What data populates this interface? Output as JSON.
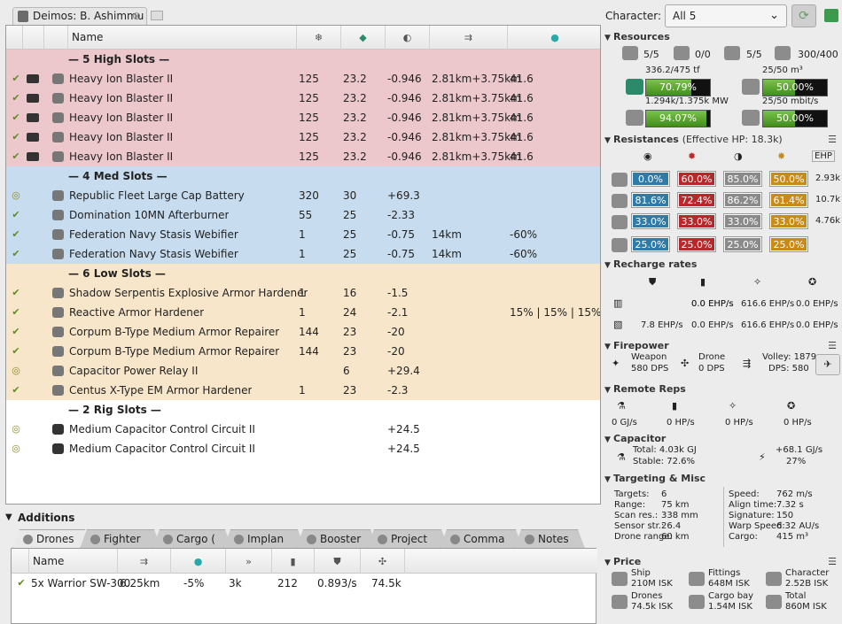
{
  "tab_title": "Deimos: B. Ashimmu",
  "columns": {
    "name": "Name"
  },
  "slot_sections": [
    {
      "id": "high",
      "label": "— 5 High Slots —",
      "color": "#ecc8cc",
      "rows": [
        {
          "state": "check",
          "name": "Heavy Ion Blaster II",
          "c1": "125",
          "c2": "23.2",
          "c3": "-0.946",
          "c4": "2.81km+3.75km",
          "c5": "41.6"
        },
        {
          "state": "check",
          "name": "Heavy Ion Blaster II",
          "c1": "125",
          "c2": "23.2",
          "c3": "-0.946",
          "c4": "2.81km+3.75km",
          "c5": "41.6"
        },
        {
          "state": "check",
          "name": "Heavy Ion Blaster II",
          "c1": "125",
          "c2": "23.2",
          "c3": "-0.946",
          "c4": "2.81km+3.75km",
          "c5": "41.6"
        },
        {
          "state": "check",
          "name": "Heavy Ion Blaster II",
          "c1": "125",
          "c2": "23.2",
          "c3": "-0.946",
          "c4": "2.81km+3.75km",
          "c5": "41.6"
        },
        {
          "state": "check",
          "name": "Heavy Ion Blaster II",
          "c1": "125",
          "c2": "23.2",
          "c3": "-0.946",
          "c4": "2.81km+3.75km",
          "c5": "41.6"
        }
      ]
    },
    {
      "id": "med",
      "label": "— 4 Med Slots —",
      "color": "#c7dcef",
      "rows": [
        {
          "state": "circle",
          "name": "Republic Fleet Large Cap Battery",
          "c1": "320",
          "c2": "30",
          "c3": "+69.3",
          "c4": "",
          "c5": ""
        },
        {
          "state": "check",
          "name": "Domination 10MN Afterburner",
          "c1": "55",
          "c2": "25",
          "c3": "-2.33",
          "c4": "",
          "c5": ""
        },
        {
          "state": "check",
          "name": "Federation Navy Stasis Webifier",
          "c1": "1",
          "c2": "25",
          "c3": "-0.75",
          "c4": "14km",
          "c5": "-60%"
        },
        {
          "state": "check",
          "name": "Federation Navy Stasis Webifier",
          "c1": "1",
          "c2": "25",
          "c3": "-0.75",
          "c4": "14km",
          "c5": "-60%"
        }
      ]
    },
    {
      "id": "low",
      "label": "— 6 Low Slots —",
      "color": "#f7e6c9",
      "rows": [
        {
          "state": "check",
          "name": "Shadow Serpentis Explosive Armor Hardener",
          "c1": "1",
          "c2": "16",
          "c3": "-1.5",
          "c4": "",
          "c5": ""
        },
        {
          "state": "check",
          "name": "Reactive Armor Hardener",
          "c1": "1",
          "c2": "24",
          "c3": "-2.1",
          "c4": "",
          "c5": "15% | 15% | 15% | 15"
        },
        {
          "state": "check",
          "name": "Corpum B-Type Medium Armor Repairer",
          "c1": "144",
          "c2": "23",
          "c3": "-20",
          "c4": "",
          "c5": ""
        },
        {
          "state": "check",
          "name": "Corpum B-Type Medium Armor Repairer",
          "c1": "144",
          "c2": "23",
          "c3": "-20",
          "c4": "",
          "c5": ""
        },
        {
          "state": "circle",
          "name": "Capacitor Power Relay II",
          "c1": "",
          "c2": "6",
          "c3": "+29.4",
          "c4": "",
          "c5": ""
        },
        {
          "state": "check",
          "name": "Centus X-Type EM Armor Hardener",
          "c1": "1",
          "c2": "23",
          "c3": "-2.3",
          "c4": "",
          "c5": ""
        }
      ]
    },
    {
      "id": "rig",
      "label": "— 2 Rig Slots —",
      "color": "#ffffff",
      "rows": [
        {
          "state": "circle",
          "name": "Medium Capacitor Control Circuit II",
          "c1": "",
          "c2": "",
          "c3": "+24.5",
          "c4": "",
          "c5": ""
        },
        {
          "state": "circle",
          "name": "Medium Capacitor Control Circuit II",
          "c1": "",
          "c2": "",
          "c3": "+24.5",
          "c4": "",
          "c5": ""
        }
      ]
    }
  ],
  "additions": {
    "label": "Additions",
    "tabs": [
      "Drones",
      "Fighter",
      "Cargo (",
      "Implan",
      "Booster",
      "Project",
      "Comma",
      "Notes"
    ],
    "drone_header": "Name",
    "drone_row": {
      "name": "5x Warrior SW-300",
      "range": "6.25km",
      "tracking": "-5%",
      "speed": "3k",
      "hp": "212",
      "dps": "0.893/s",
      "volley": "74.5k"
    }
  },
  "character": {
    "label": "Character:",
    "value": "All 5"
  },
  "resources": {
    "title": "Resources",
    "hardpoints": [
      "5/5",
      "0/0",
      "5/5",
      "300/400"
    ],
    "cpu": {
      "label": "336.2/475 tf",
      "pct": "70.79%",
      "fraction": 0.7079
    },
    "drone_bay": {
      "label": "25/50 m³",
      "pct": "50.00%",
      "fraction": 0.5
    },
    "power": {
      "label": "1.294k/1.375k MW",
      "pct": "94.07%",
      "fraction": 0.9407
    },
    "bandwidth": {
      "label": "25/50 mbit/s",
      "pct": "50.00%",
      "fraction": 0.5
    }
  },
  "resistances": {
    "title": "Resistances",
    "ehp": "(Effective HP: 18.3k)",
    "ehp_col": "EHP",
    "rows": [
      {
        "vals": [
          "0.0%",
          "60.0%",
          "85.0%",
          "50.0%"
        ],
        "ehp": "2.93k"
      },
      {
        "vals": [
          "81.6%",
          "72.4%",
          "86.2%",
          "61.4%"
        ],
        "ehp": "10.7k"
      },
      {
        "vals": [
          "33.0%",
          "33.0%",
          "33.0%",
          "33.0%"
        ],
        "ehp": "4.76k"
      },
      {
        "vals": [
          "25.0%",
          "25.0%",
          "25.0%",
          "25.0%"
        ],
        "ehp": ""
      }
    ],
    "colors": [
      "#2e7aa8",
      "#b8282a",
      "#8a8a8a",
      "#c98a16"
    ]
  },
  "recharge": {
    "title": "Recharge rates",
    "row1": [
      "0.0 EHP/s",
      "0.0 EHP/s",
      "616.6 EHP/s",
      "0.0 EHP/s"
    ],
    "row2": [
      "7.8 EHP/s",
      "0.0 EHP/s",
      "616.6 EHP/s",
      "0.0 EHP/s"
    ]
  },
  "firepower": {
    "title": "Firepower",
    "weapon_label": "Weapon",
    "weapon_val": "580 DPS",
    "drone_label": "Drone",
    "drone_val": "0 DPS",
    "volley": "Volley: 1879",
    "dps": "DPS: 580"
  },
  "remote": {
    "title": "Remote Reps",
    "vals": [
      "0 GJ/s",
      "0 HP/s",
      "0 HP/s",
      "0 HP/s"
    ]
  },
  "capacitor": {
    "title": "Capacitor",
    "total": "Total: 4.03k GJ",
    "stable": "Stable: 72.6%",
    "delta": "+68.1 GJ/s",
    "pct": "27%"
  },
  "targeting": {
    "title": "Targeting & Misc",
    "left": [
      [
        "Targets:",
        "6"
      ],
      [
        "Range:",
        "75 km"
      ],
      [
        "Scan res.:",
        "338 mm"
      ],
      [
        "Sensor str.:",
        "26.4"
      ],
      [
        "Drone range:",
        "60 km"
      ]
    ],
    "right": [
      [
        "Speed:",
        "762 m/s"
      ],
      [
        "Align time:",
        "7.32 s"
      ],
      [
        "Signature:",
        "150"
      ],
      [
        "Warp Speed:",
        "6.32 AU/s"
      ],
      [
        "Cargo:",
        "415 m³"
      ]
    ]
  },
  "price": {
    "title": "Price",
    "items": [
      [
        "Ship",
        "210M ISK"
      ],
      [
        "Fittings",
        "648M ISK"
      ],
      [
        "Character",
        "2.52B ISK"
      ],
      [
        "Drones",
        "74.5k ISK"
      ],
      [
        "Cargo bay",
        "1.54M ISK"
      ],
      [
        "Total",
        "860M ISK"
      ]
    ]
  }
}
